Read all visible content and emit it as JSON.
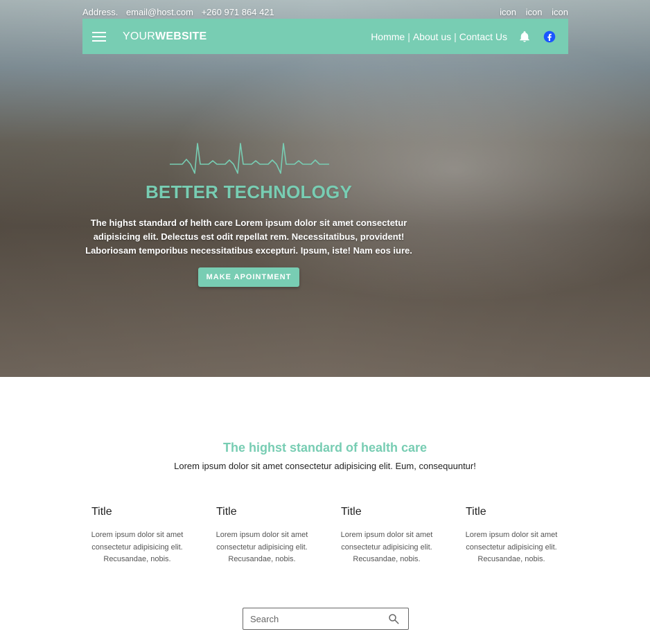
{
  "topbar": {
    "address": "Address.",
    "email": "email@host.com",
    "phone": "+260 971 864 421",
    "icons": [
      "icon",
      "icon",
      "icon"
    ]
  },
  "navbar": {
    "brand_light": "YOUR",
    "brand_bold": "WEBSITE",
    "links": [
      "Homme",
      "About us",
      "Contact Us"
    ],
    "separator": "|",
    "accent_color": "#78cdb3"
  },
  "hero": {
    "title": "BETTER TECHNOLOGY",
    "text": "The highst standard of helth care Lorem ipsum dolor sit amet consectetur adipisicing elit. Delectus est odit repellat rem. Necessitatibus, provident! Laboriosam temporibus necessitatibus excepturi. Ipsum, iste! Nam eos iure.",
    "button_label": "MAKE APOINTMENT"
  },
  "section": {
    "title": "The highst standard of health care",
    "subtitle": "Lorem ipsum dolor sit amet consectetur adipisicing elit. Eum, consequuntur!",
    "cards": [
      {
        "title": "Title",
        "text": "Lorem ipsum dolor sit amet consectetur adipisicing elit. Recusandae, nobis."
      },
      {
        "title": "Title",
        "text": "Lorem ipsum dolor sit amet consectetur adipisicing elit. Recusandae, nobis."
      },
      {
        "title": "Title",
        "text": "Lorem ipsum dolor sit amet consectetur adipisicing elit. Recusandae, nobis."
      },
      {
        "title": "Title",
        "text": "Lorem ipsum dolor sit amet consectetur adipisicing elit. Recusandae, nobis."
      }
    ]
  },
  "search": {
    "placeholder": "Search",
    "icon": "search-icon"
  }
}
